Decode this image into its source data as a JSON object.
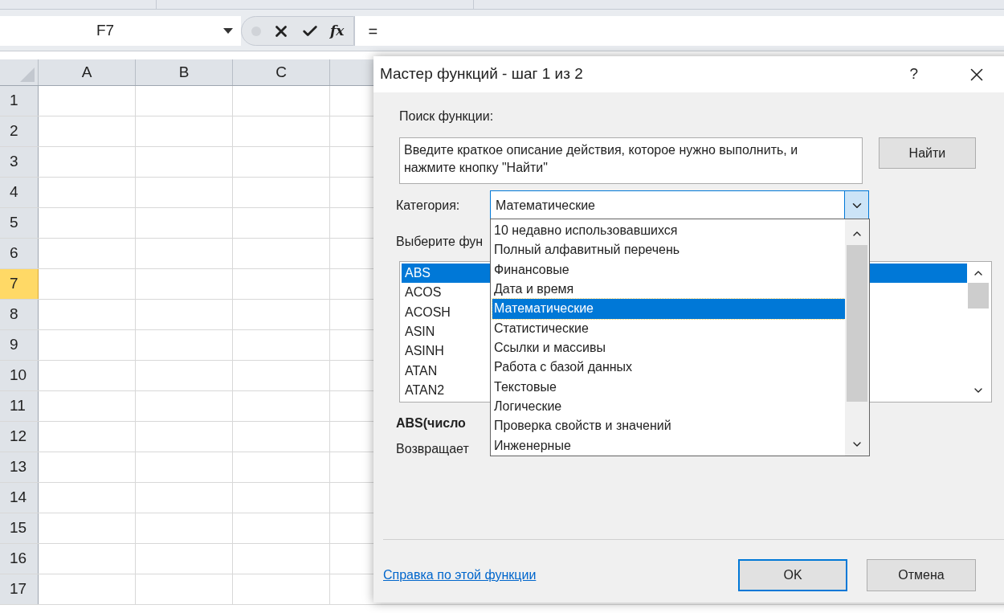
{
  "formula_bar": {
    "name_box": "F7",
    "formula": "=",
    "insert_function": "fx"
  },
  "sheet": {
    "columns": [
      "A",
      "B",
      "C"
    ],
    "rows": [
      {
        "label": "1",
        "selected": false
      },
      {
        "label": "2",
        "selected": false
      },
      {
        "label": "3",
        "selected": false
      },
      {
        "label": "4",
        "selected": false
      },
      {
        "label": "5",
        "selected": false
      },
      {
        "label": "6",
        "selected": false
      },
      {
        "label": "7",
        "selected": true
      },
      {
        "label": "8",
        "selected": false
      },
      {
        "label": "9",
        "selected": false
      },
      {
        "label": "10",
        "selected": false
      },
      {
        "label": "11",
        "selected": false
      },
      {
        "label": "12",
        "selected": false
      },
      {
        "label": "13",
        "selected": false
      },
      {
        "label": "14",
        "selected": false
      },
      {
        "label": "15",
        "selected": false
      },
      {
        "label": "16",
        "selected": false
      },
      {
        "label": "17",
        "selected": false
      }
    ]
  },
  "dialog": {
    "title": "Мастер функций - шаг 1 из 2",
    "help": "?",
    "search": {
      "label": "Поиск функции:",
      "value": "Введите краткое описание действия, которое нужно выполнить, и нажмите кнопку \"Найти\"",
      "button": "Найти"
    },
    "category": {
      "label": "Категория:",
      "value": "Математические",
      "expanded": true,
      "options": [
        {
          "label": "10 недавно использовавшихся",
          "selected": false
        },
        {
          "label": "Полный алфавитный перечень",
          "selected": false
        },
        {
          "label": "Финансовые",
          "selected": false
        },
        {
          "label": "Дата и время",
          "selected": false
        },
        {
          "label": "Математические",
          "selected": true
        },
        {
          "label": "Статистические",
          "selected": false
        },
        {
          "label": "Ссылки и массивы",
          "selected": false
        },
        {
          "label": "Работа с базой данных",
          "selected": false
        },
        {
          "label": "Текстовые",
          "selected": false
        },
        {
          "label": "Логические",
          "selected": false
        },
        {
          "label": "Проверка свойств и значений",
          "selected": false
        },
        {
          "label": "Инженерные",
          "selected": false
        }
      ]
    },
    "function_list": {
      "label": "Выберите фун",
      "items": [
        {
          "name": "ABS",
          "selected": true
        },
        {
          "name": "ACOS",
          "selected": false
        },
        {
          "name": "ACOSH",
          "selected": false
        },
        {
          "name": "ASIN",
          "selected": false
        },
        {
          "name": "ASINH",
          "selected": false
        },
        {
          "name": "ATAN",
          "selected": false
        },
        {
          "name": "ATAN2",
          "selected": false
        }
      ]
    },
    "signature": "ABS(число",
    "description": "Возвращает",
    "help_link": "Справка по этой функции",
    "buttons": [
      {
        "label": "OK",
        "default": true
      },
      {
        "label": "Отмена",
        "default": false
      }
    ]
  }
}
